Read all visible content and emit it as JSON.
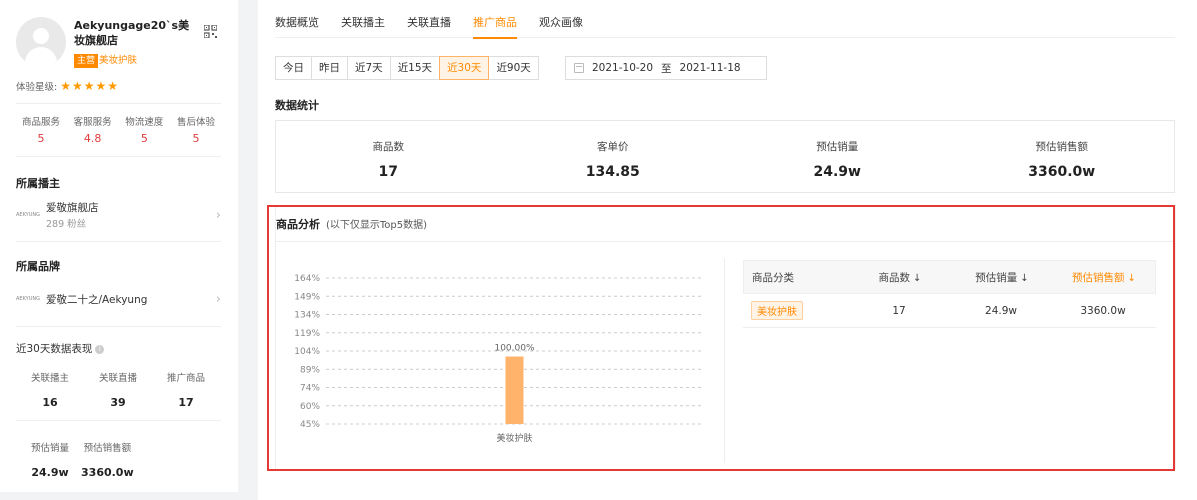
{
  "shop": {
    "name": "Aekyungage20`s美妆旗舰店",
    "tag_main": "主营",
    "tag_category": "美妆护肤",
    "rating_label": "体验星级:",
    "stars": "★★★★★",
    "scores": [
      {
        "label": "商品服务",
        "value": "5"
      },
      {
        "label": "客服服务",
        "value": "4.8"
      },
      {
        "label": "物流速度",
        "value": "5"
      },
      {
        "label": "售后体验",
        "value": "5"
      }
    ]
  },
  "anchor": {
    "title": "所属播主",
    "name": "爱敬旗舰店",
    "fans": "289 粉丝",
    "logo_text": "AEKYUNG"
  },
  "brand": {
    "title": "所属品牌",
    "name": "爱敬二十之/Aekyung",
    "logo_text": "AEKYUNG"
  },
  "perf": {
    "title": "近30天数据表现",
    "info_icon": "i",
    "stats": [
      {
        "label": "关联播主",
        "value": "16"
      },
      {
        "label": "关联直播",
        "value": "39"
      },
      {
        "label": "推广商品",
        "value": "17"
      }
    ],
    "stats2": [
      {
        "label": "预估销量",
        "value": "24.9w"
      },
      {
        "label": "预估销售额",
        "value": "3360.0w"
      }
    ]
  },
  "tabs": [
    "数据概览",
    "关联播主",
    "关联直播",
    "推广商品",
    "观众画像"
  ],
  "active_tab": 3,
  "ranges": [
    "今日",
    "昨日",
    "近7天",
    "近15天",
    "近30天",
    "近90天"
  ],
  "active_range": 4,
  "date": {
    "start": "2021-10-20",
    "sep": "至",
    "end": "2021-11-18"
  },
  "stats_title": "数据统计",
  "stats": [
    {
      "label": "商品数",
      "value": "17"
    },
    {
      "label": "客单价",
      "value": "134.85"
    },
    {
      "label": "预估销量",
      "value": "24.9w"
    },
    {
      "label": "预估销售额",
      "value": "3360.0w"
    }
  ],
  "analysis": {
    "title": "商品分析",
    "note": "(以下仅显示Top5数据)"
  },
  "chart_data": {
    "type": "bar",
    "categories": [
      "美妆护肤"
    ],
    "values": [
      100
    ],
    "data_labels": [
      "100.00%"
    ],
    "yticks": [
      "164%",
      "149%",
      "134%",
      "119%",
      "104%",
      "89%",
      "74%",
      "60%",
      "45%"
    ],
    "ylim": [
      45,
      164
    ],
    "grid": true,
    "color": "#ffb36b"
  },
  "table": {
    "headers": [
      "商品分类",
      "商品数",
      "预估销量",
      "预估销售额"
    ],
    "sort_icon": "↓",
    "rows": [
      {
        "category": "美妆护肤",
        "count": "17",
        "sales": "24.9w",
        "revenue": "3360.0w"
      }
    ]
  },
  "colors": {
    "accent": "#ff8a00",
    "frame": "#e53935"
  }
}
